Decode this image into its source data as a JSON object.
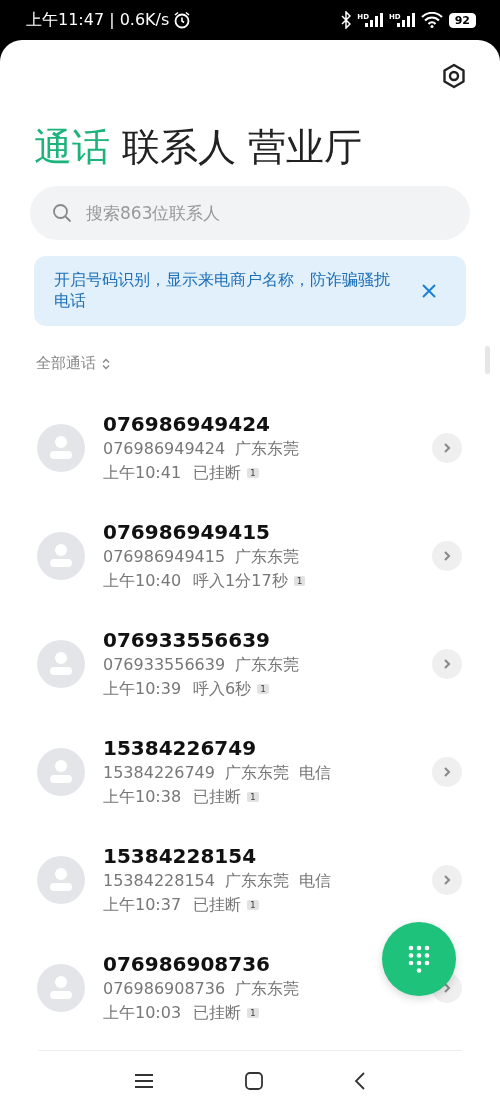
{
  "status_bar": {
    "time": "上午11:47 | 0.6K/s",
    "battery": "92",
    "signal_labels": [
      "HD",
      "HD"
    ]
  },
  "tabs": [
    {
      "label": "通话",
      "selected": true
    },
    {
      "label": "联系人",
      "selected": false
    },
    {
      "label": "营业厅",
      "selected": false
    }
  ],
  "search": {
    "placeholder": "搜索863位联系人"
  },
  "banner": {
    "text": "开启号码识别，显示来电商户名称，防诈骗骚扰电话"
  },
  "filter": {
    "label": "全部通话"
  },
  "calls": [
    {
      "number": "076986949424",
      "detail": "076986949424  广东东莞",
      "time": "上午10:41",
      "status": "已挂断",
      "count": "1"
    },
    {
      "number": "076986949415",
      "detail": "076986949415  广东东莞",
      "time": "上午10:40",
      "status": "呼入1分17秒",
      "count": "1"
    },
    {
      "number": "076933556639",
      "detail": "076933556639  广东东莞",
      "time": "上午10:39",
      "status": "呼入6秒",
      "count": "1"
    },
    {
      "number": "15384226749",
      "detail": "15384226749  广东东莞  电信",
      "time": "上午10:38",
      "status": "已挂断",
      "count": "1"
    },
    {
      "number": "15384228154",
      "detail": "15384228154  广东东莞  电信",
      "time": "上午10:37",
      "status": "已挂断",
      "count": "1"
    },
    {
      "number": "076986908736",
      "detail": "076986908736  广东东莞",
      "time": "上午10:03",
      "status": "已挂断",
      "count": "1"
    }
  ]
}
